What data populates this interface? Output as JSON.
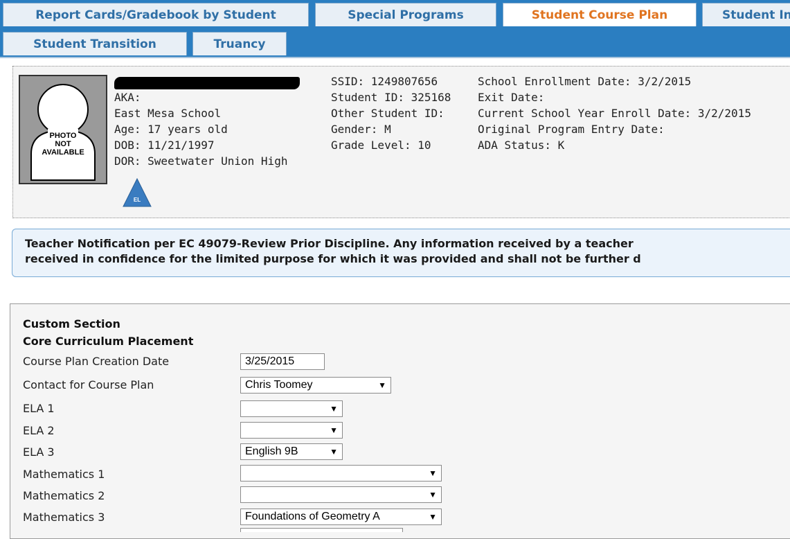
{
  "tabs": {
    "row1": [
      {
        "label": "Report Cards/Gradebook by Student"
      },
      {
        "label": "Special Programs"
      },
      {
        "label": "Student Course Plan",
        "active": true
      },
      {
        "label": "Student In"
      }
    ],
    "row2": [
      {
        "label": "Student Transition"
      },
      {
        "label": "Truancy"
      }
    ]
  },
  "student": {
    "photo_text": [
      "PHOTO",
      "NOT",
      "AVAILABLE"
    ],
    "col1": [
      "AKA:",
      "East Mesa School",
      "Age: 17 years old",
      "DOB: 11/21/1997",
      "DOR: Sweetwater Union High"
    ],
    "col2": [
      "SSID: 1249807656",
      "Student ID: 325168",
      "Other Student ID:",
      "Gender: M",
      "Grade Level: 10"
    ],
    "col3": [
      "School Enrollment Date: 3/2/2015",
      "Exit Date:",
      "Current School Year Enroll Date: 3/2/2015",
      "Original Program Entry Date:",
      "ADA Status: K"
    ],
    "badge_label": "EL",
    "badge_color": "#3a7cc0"
  },
  "notice": {
    "line1": "Teacher Notification per EC 49079-Review Prior Discipline. Any information received by a teacher",
    "line2": "received in confidence for the limited purpose for which it was provided and shall not be further d"
  },
  "section": {
    "title": "Custom Section",
    "subtitle": "Core Curriculum Placement",
    "rows": [
      {
        "label": "Course Plan Creation Date",
        "value": "3/25/2015"
      },
      {
        "label": "Contact for Course Plan",
        "value": "Chris Toomey"
      },
      {
        "label": "ELA 1",
        "value": ""
      },
      {
        "label": "ELA 2",
        "value": ""
      },
      {
        "label": "ELA 3",
        "value": "English 9B"
      },
      {
        "label": "Mathematics 1",
        "value": ""
      },
      {
        "label": "Mathematics 2",
        "value": ""
      },
      {
        "label": "Mathematics 3",
        "value": "Foundations of Geometry A"
      }
    ]
  },
  "colors": {
    "tab_bar": "#2b7ec1",
    "tab_text": "#2f6fa6",
    "tab_active_text": "#e07420"
  }
}
